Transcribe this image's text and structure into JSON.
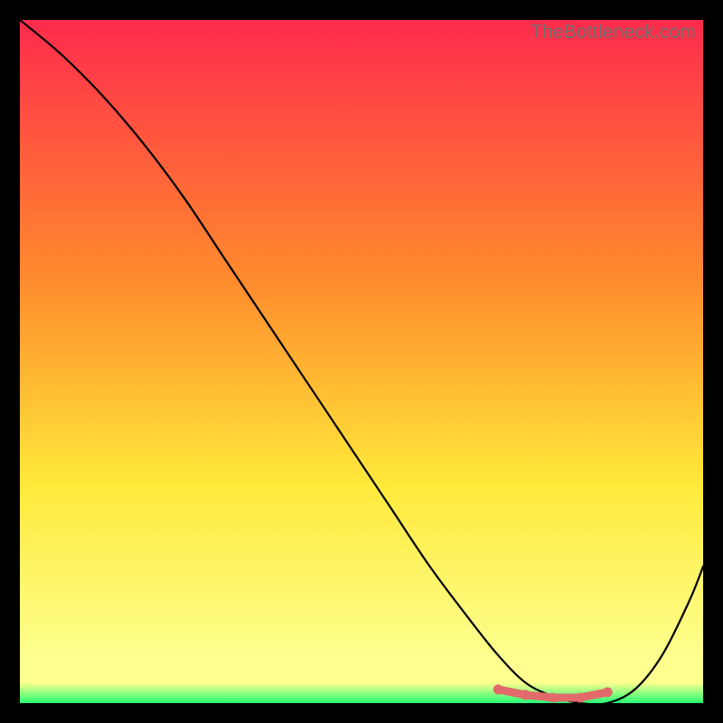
{
  "watermark": "TheBottleneck.com",
  "colors": {
    "gradient_top": "#ff2b4d",
    "gradient_mid1": "#ff8b2d",
    "gradient_mid2": "#ffe93a",
    "gradient_low": "#fdff8e",
    "gradient_bottom": "#26ff73",
    "curve": "#000000",
    "marker": "#e26a6a",
    "frame_bg": "#000000"
  },
  "chart_data": {
    "type": "line",
    "title": "",
    "xlabel": "",
    "ylabel": "",
    "xlim": [
      0,
      100
    ],
    "ylim": [
      0,
      100
    ],
    "grid": false,
    "legend": false,
    "series": [
      {
        "name": "bottleneck-curve",
        "x": [
          0,
          6,
          12,
          18,
          24,
          30,
          36,
          42,
          48,
          54,
          60,
          66,
          70,
          74,
          78,
          82,
          86,
          90,
          94,
          98,
          100
        ],
        "values": [
          100,
          95,
          89,
          82,
          74,
          65,
          56,
          47,
          38,
          29,
          20,
          12,
          7,
          3,
          1,
          0,
          0,
          2,
          7,
          15,
          20
        ]
      }
    ],
    "highlight_range": {
      "name": "optimal-zone",
      "x": [
        70,
        74,
        78,
        82,
        86
      ],
      "values": [
        2,
        1.2,
        0.8,
        0.8,
        1.6
      ]
    }
  }
}
